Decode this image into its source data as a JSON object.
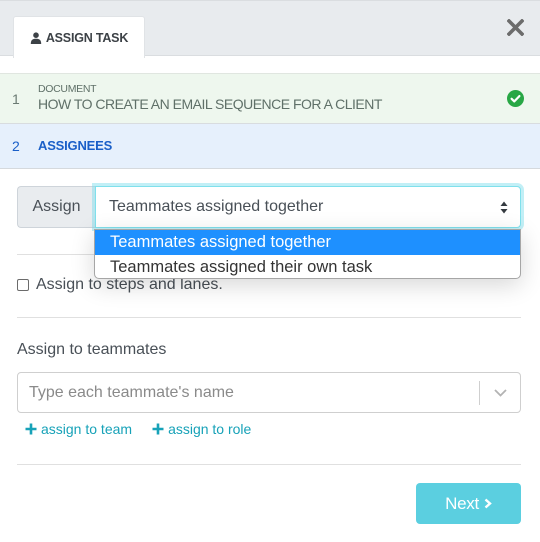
{
  "header": {
    "tab_label": "ASSIGN TASK",
    "tab_icon": "user-icon",
    "close_icon": "close-icon"
  },
  "steps": [
    {
      "number": "1",
      "subtitle": "DOCUMENT",
      "title": "HOW TO CREATE AN EMAIL SEQUENCE FOR A CLIENT",
      "status": "complete",
      "status_icon": "check-circle-icon"
    },
    {
      "number": "2",
      "title": "ASSIGNEES",
      "status": "active"
    }
  ],
  "assign": {
    "label": "Assign",
    "selected": "Teammates assigned together",
    "options": [
      "Teammates assigned together",
      "Teammates assigned their own task"
    ],
    "highlighted_index": 0
  },
  "checkbox": {
    "label": "Assign to steps and lanes.",
    "checked": false
  },
  "teammates": {
    "label": "Assign to teammates",
    "placeholder": "Type each teammate's name",
    "value": ""
  },
  "links": [
    {
      "label": "assign to team",
      "icon": "plus-icon"
    },
    {
      "label": "assign to role",
      "icon": "plus-icon"
    }
  ],
  "footer": {
    "next_label": "Next",
    "next_icon": "chevron-right-icon"
  },
  "colors": {
    "accent": "#17a2b8",
    "next_button": "#5bcfe0",
    "active_step": "#1a5fc8",
    "complete_check": "#28a745",
    "dropdown_highlight": "#1e90ff"
  }
}
